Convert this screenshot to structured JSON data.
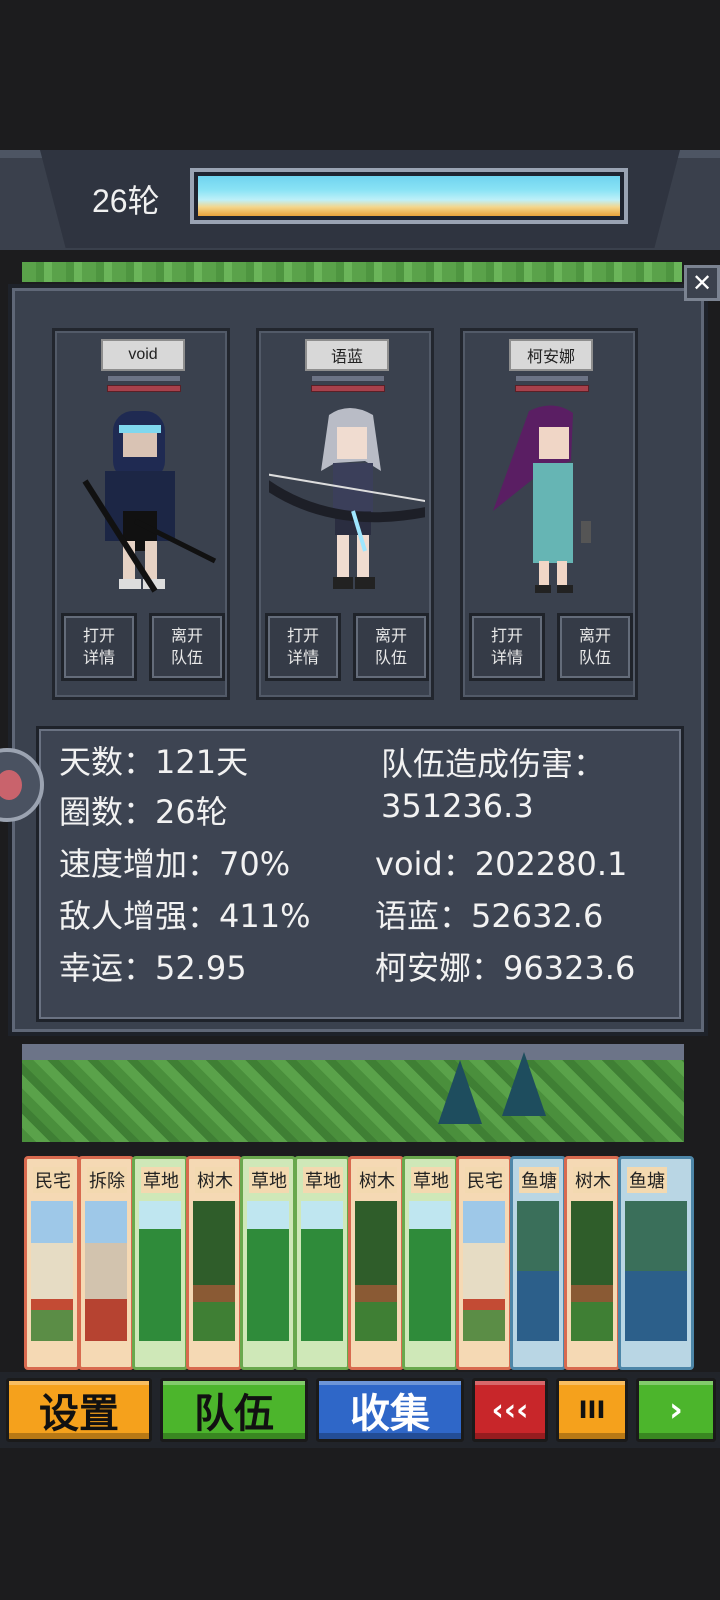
{
  "header": {
    "round_label": "26轮"
  },
  "panel": {
    "close_glyph": "✕",
    "characters": [
      {
        "name": "void",
        "open_details": "打开\n详情",
        "leave_team": "离开\n队伍"
      },
      {
        "name": "语蓝",
        "open_details": "打开\n详情",
        "leave_team": "离开\n队伍"
      },
      {
        "name": "柯安娜",
        "open_details": "打开\n详情",
        "leave_team": "离开\n队伍"
      }
    ],
    "stats": {
      "days": "天数：121天",
      "laps": "圈数：26轮",
      "speed": "速度增加：70%",
      "enemy_boost": "敌人增强：411%",
      "luck": "幸运：52.95",
      "team_damage_label": "队伍造成伤害：",
      "team_damage_value": "351236.3",
      "void_damage": "void：202280.1",
      "yulan_damage": "语蓝：52632.6",
      "keanna_damage": "柯安娜：96323.6"
    }
  },
  "tiles": [
    "民宅",
    "拆除",
    "草地",
    "树木",
    "草地",
    "草地",
    "树木",
    "草地",
    "民宅",
    "鱼塘",
    "树木",
    "鱼塘"
  ],
  "bottom_buttons": {
    "settings": "设置",
    "team": "队伍",
    "collect": "收集",
    "rewind": "‹‹‹",
    "pause": "III",
    "play": "›"
  },
  "colors": {
    "settings": "#f5a11c",
    "team": "#4cb52c",
    "collect": "#2f67c8",
    "rewind": "#c8262a",
    "pause": "#f5a11c",
    "play": "#4cb52c"
  }
}
